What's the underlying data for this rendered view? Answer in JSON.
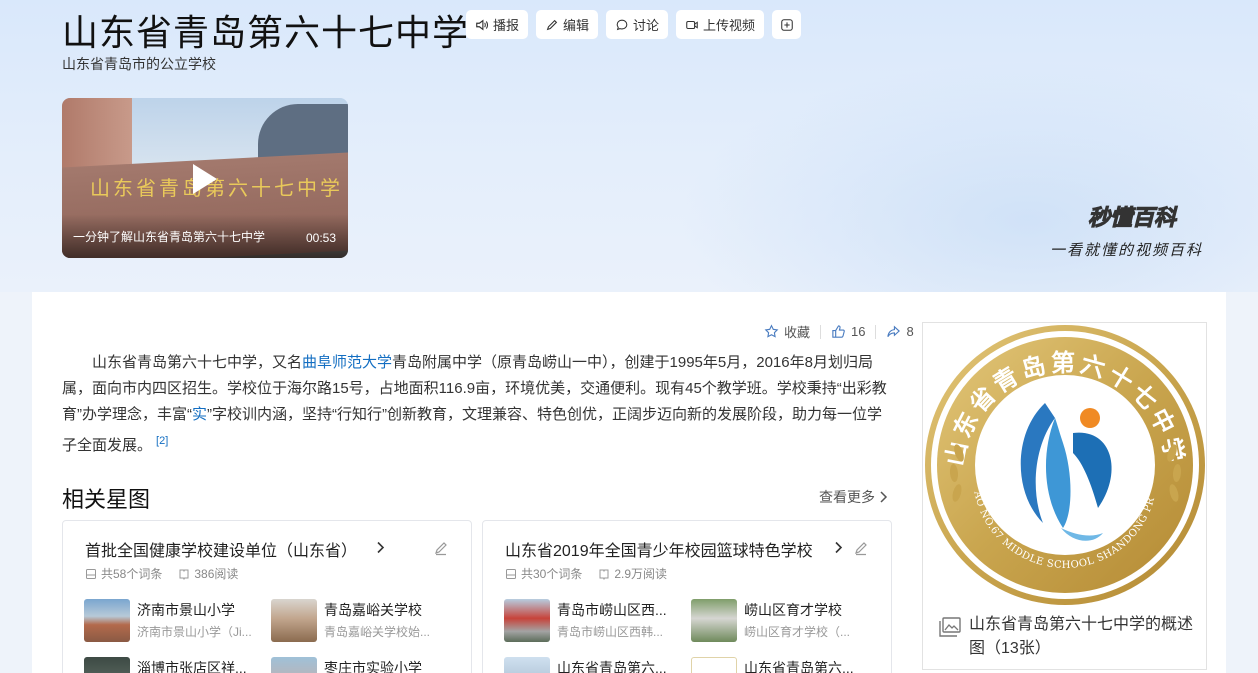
{
  "header": {
    "title": "山东省青岛第六十七中学",
    "subtitle": "山东省青岛市的公立学校",
    "actions": {
      "broadcast": "播报",
      "edit": "编辑",
      "discuss": "讨论",
      "upload_video": "上传视频"
    }
  },
  "video": {
    "sign_text": "山东省青岛第六十七中学",
    "caption": "一分钟了解山东省青岛第六十七中学",
    "duration": "00:53"
  },
  "brand": {
    "name": "秒懂百科",
    "slogan": "一看就懂的视频百科"
  },
  "stats": {
    "favorite_label": "收藏",
    "likes": "16",
    "shares": "8"
  },
  "intro": {
    "part1": "山东省青岛第六十七中学，又名",
    "link1": "曲阜师范大学",
    "part2": "青岛附属中学（原青岛崂山一中），创建于1995年5月，2016年8月划归局属，面向市内四区招生。学校位于海尔路15号，占地面积116.9亩，环境优美，交通便利。现有45个教学班。学校秉持“出彩教育”办学理念，丰富“",
    "link2": "实",
    "part3": "”字校训内涵，坚持“行知行”创新教育，文理兼容、特色创优，正阔步迈向新的发展阶段，助力每一位学子全面发展。",
    "ref": "[2]"
  },
  "related": {
    "title": "相关星图",
    "more": "查看更多",
    "panels": [
      {
        "title": "首批全国健康学校建设单位（山东省）",
        "entries_count": "共58个词条",
        "reads": "386阅读",
        "items": [
          {
            "name": "济南市景山小学",
            "desc": "济南市景山小学（Ji..."
          },
          {
            "name": "青岛嘉峪关学校",
            "desc": "青岛嘉峪关学校始..."
          },
          {
            "name": "淄博市张店区祥...",
            "desc": ""
          },
          {
            "name": "枣庄市实验小学",
            "desc": ""
          }
        ]
      },
      {
        "title": "山东省2019年全国青少年校园篮球特色学校",
        "entries_count": "共30个词条",
        "reads": "2.9万阅读",
        "items": [
          {
            "name": "青岛市崂山区西...",
            "desc": "青岛市崂山区西韩..."
          },
          {
            "name": "崂山区育才学校",
            "desc": "崂山区育才学校（..."
          },
          {
            "name": "山东省青岛第六...",
            "desc": ""
          },
          {
            "name": "山东省青岛第六...",
            "desc": ""
          }
        ]
      }
    ]
  },
  "photo": {
    "logo_text_top": "山东省青岛第六十七中学",
    "logo_text_bottom": "QINGDAO NO.67 MIDDLE SCHOOL SHANDONG PROVINCE",
    "caption": "山东省青岛第六十七中学的概述图（13张）"
  },
  "colors": {
    "link": "#136ec2",
    "gold": "#c9a54e",
    "logo_blue": "#2a78c0",
    "logo_orange": "#f08a24"
  }
}
